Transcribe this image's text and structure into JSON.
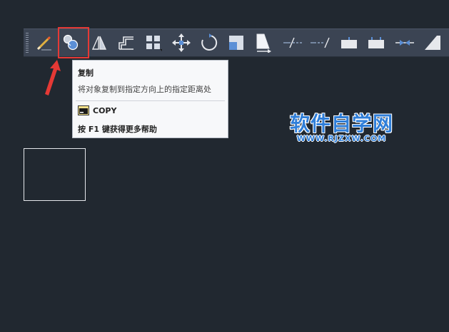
{
  "colors": {
    "canvas_bg": "#212830",
    "toolbar_bg": "#3b4453",
    "highlight": "#e53935",
    "watermark": "#2f7ed8"
  },
  "toolbar": {
    "buttons": [
      {
        "id": "erase",
        "icon": "eraser-pencil-icon"
      },
      {
        "id": "copy",
        "icon": "copy-circles-icon",
        "selected": true
      },
      {
        "id": "mirror",
        "icon": "mirror-triangles-icon"
      },
      {
        "id": "offset",
        "icon": "offset-shape-icon"
      },
      {
        "id": "array",
        "icon": "array-grid-icon"
      },
      {
        "id": "move",
        "icon": "move-arrows-icon"
      },
      {
        "id": "rotate",
        "icon": "rotate-circle-icon"
      },
      {
        "id": "scale",
        "icon": "scale-squares-icon"
      },
      {
        "id": "stretch",
        "icon": "stretch-shape-icon"
      },
      {
        "id": "trim",
        "icon": "trim-line-icon"
      },
      {
        "id": "extend",
        "icon": "extend-line-icon"
      },
      {
        "id": "break-at-point",
        "icon": "break-point-icon"
      },
      {
        "id": "break",
        "icon": "break-icon"
      },
      {
        "id": "join",
        "icon": "join-arrows-icon"
      },
      {
        "id": "chamfer",
        "icon": "chamfer-icon"
      }
    ]
  },
  "tooltip": {
    "title": "复制",
    "description": "将对象复制到指定方向上的指定距离处",
    "command": "COPY",
    "help_hint": "按 F1 键获得更多帮助"
  },
  "watermark": {
    "text": "软件自学网",
    "url": "WWW.RJZXW.COM"
  }
}
